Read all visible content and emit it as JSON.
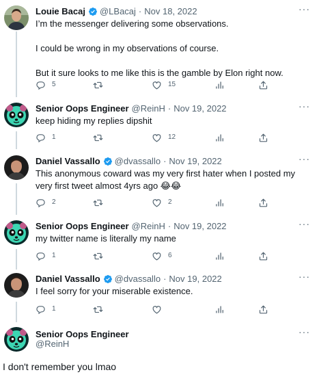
{
  "colors": {
    "verified": "#1d9bf0",
    "muted": "#536471",
    "text": "#0f1419",
    "thread": "#cfd9de"
  },
  "icons": {
    "reply": "comment-bubble",
    "retweet": "retweet-arrows",
    "like": "heart-outline",
    "views": "bar-chart",
    "share": "share-arrow-up",
    "more": "horizontal-ellipsis",
    "verified": "blue-check-badge"
  },
  "tweets": [
    {
      "name": "Louie Bacaj",
      "handle": "@LBacaj",
      "dot": "·",
      "date": "Nov 18, 2022",
      "verified": true,
      "text": "I’m the messenger delivering some observations.\n\nI could be wrong in my observations of course.\n\nBut it sure looks to me like this is the gamble by Elon right now.",
      "replies": "5",
      "retweets": "",
      "likes": "15",
      "views": ""
    },
    {
      "name": "Senior Oops Engineer",
      "handle": "@ReinH",
      "dot": "·",
      "date": "Nov 19, 2022",
      "verified": false,
      "text": "keep hiding my replies dipshit",
      "replies": "1",
      "retweets": "",
      "likes": "12",
      "views": ""
    },
    {
      "name": "Daniel Vassallo",
      "handle": "@dvassallo",
      "dot": "·",
      "date": "Nov 19, 2022",
      "verified": true,
      "text": "This anonymous coward was my very first hater when I posted my very first tweet almost 4yrs ago 😂😂",
      "replies": "2",
      "retweets": "",
      "likes": "2",
      "views": ""
    },
    {
      "name": "Senior Oops Engineer",
      "handle": "@ReinH",
      "dot": "·",
      "date": "Nov 19, 2022",
      "verified": false,
      "text": "my twitter name is literally my name",
      "replies": "1",
      "retweets": "",
      "likes": "6",
      "views": ""
    },
    {
      "name": "Daniel Vassallo",
      "handle": "@dvassallo",
      "dot": "·",
      "date": "Nov 19, 2022",
      "verified": true,
      "text": "I feel sorry for your miserable existence.",
      "replies": "1",
      "retweets": "",
      "likes": "",
      "views": ""
    }
  ],
  "focused": {
    "name": "Senior Oops Engineer",
    "handle": "@ReinH",
    "text": "I don't remember you lmao"
  }
}
